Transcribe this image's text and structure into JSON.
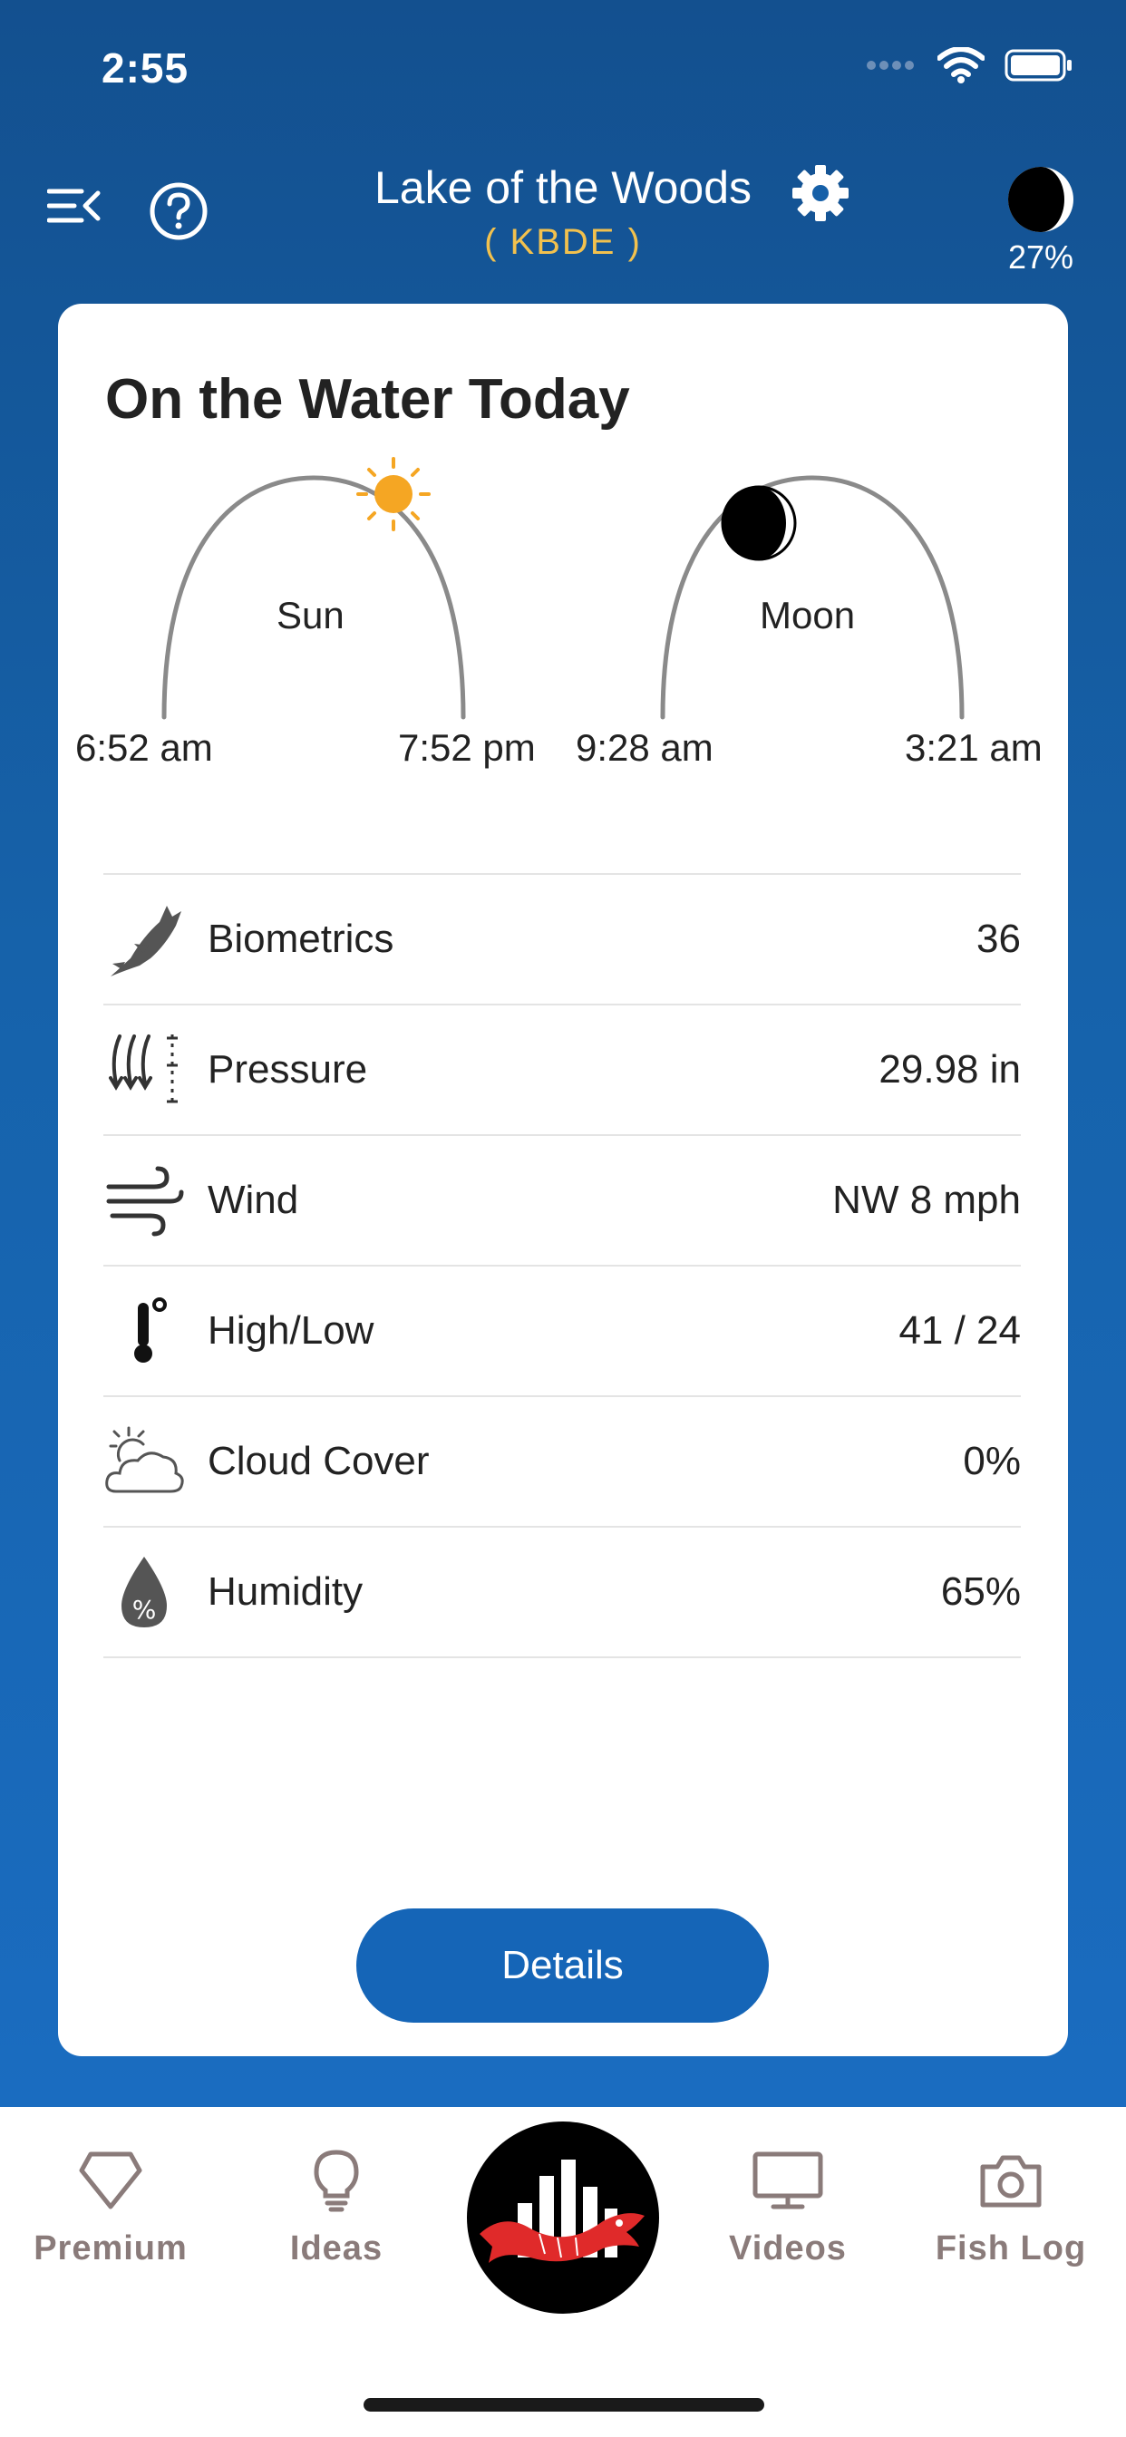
{
  "status_bar": {
    "time": "2:55"
  },
  "header": {
    "location_name": "Lake of the Woods",
    "location_code": "( KBDE )",
    "moon_percent": "27%"
  },
  "card": {
    "title": "On the Water Today",
    "sun": {
      "label": "Sun",
      "rise": "6:52 am",
      "set": "7:52 pm"
    },
    "moon": {
      "label": "Moon",
      "rise": "9:28 am",
      "set": "3:21 am"
    },
    "rows": [
      {
        "icon": "fish-icon",
        "label": "Biometrics",
        "value": "36"
      },
      {
        "icon": "pressure-icon",
        "label": "Pressure",
        "value": "29.98 in"
      },
      {
        "icon": "wind-icon",
        "label": "Wind",
        "value": "NW 8 mph"
      },
      {
        "icon": "thermometer-icon",
        "label": "High/Low",
        "value": "41 / 24"
      },
      {
        "icon": "cloud-sun-icon",
        "label": "Cloud Cover",
        "value": "0%"
      },
      {
        "icon": "humidity-drop-icon",
        "label": "Humidity",
        "value": "65%"
      }
    ],
    "details_label": "Details"
  },
  "tabbar": {
    "premium": "Premium",
    "ideas": "Ideas",
    "videos": "Videos",
    "fish_log": "Fish Log"
  },
  "colors": {
    "accent": "#1565b7",
    "location_code": "#f2c14e",
    "sun": "#f5a623",
    "tab_text": "#8a7b7a"
  }
}
